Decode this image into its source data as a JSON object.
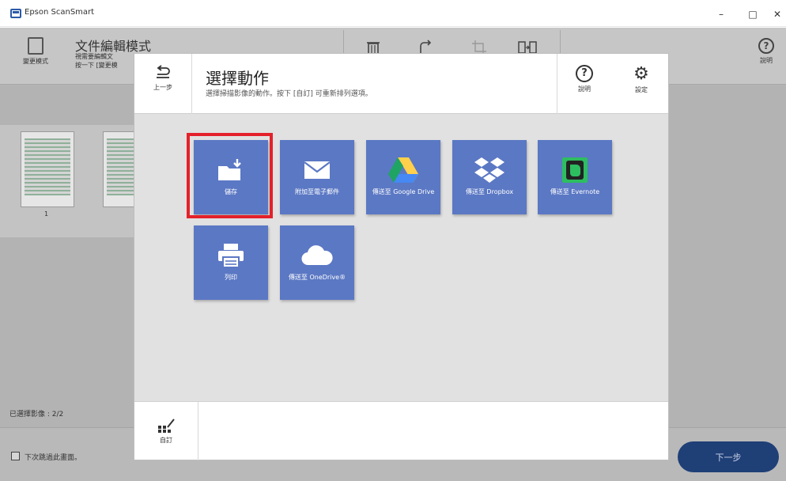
{
  "window": {
    "title": "Epson ScanSmart",
    "controls": {
      "minimize": "–",
      "maximize": "□",
      "close": "✕"
    }
  },
  "background_app": {
    "mode_button_label": "變更模式",
    "mode_title": "文件編輯模式",
    "mode_desc_line1": "視需要編輯文",
    "mode_desc_line2": "按一下 [變更模",
    "toolbar_icons": [
      "trash-icon",
      "rotate-icon",
      "crop-icon",
      "split-icon"
    ],
    "help_label": "說明",
    "thumbnail_number": "1",
    "selected_count": "已選擇影像 : 2/2",
    "skip_checkbox_label": "下次跳過此畫面。",
    "next_button_label": "下一步"
  },
  "dialog": {
    "back_label": "上一步",
    "title": "選擇動作",
    "description": "選擇掃描影像的動作。按下 [自訂] 可重新排列選項。",
    "help_label": "說明",
    "settings_label": "設定",
    "custom_label": "自訂",
    "tiles": [
      {
        "label": "儲存",
        "icon": "folder-download-icon"
      },
      {
        "label": "附加至電子郵件",
        "icon": "envelope-icon"
      },
      {
        "label": "傳送至 Google Drive",
        "icon": "google-drive-icon"
      },
      {
        "label": "傳送至 Dropbox",
        "icon": "dropbox-icon"
      },
      {
        "label": "傳送至 Evernote",
        "icon": "evernote-icon"
      },
      {
        "label": "列印",
        "icon": "printer-icon"
      },
      {
        "label": "傳送至 OneDrive®",
        "icon": "cloud-icon"
      }
    ],
    "selected_tile": "儲存"
  },
  "colors": {
    "tile_blue": "#5b78c4",
    "highlight_red": "#e3212b",
    "next_button": "#1f3f77",
    "drive_green": "#1fa463",
    "drive_yellow": "#ffd04b",
    "drive_blue": "#4688f4",
    "evernote_green": "#2dbe60"
  }
}
